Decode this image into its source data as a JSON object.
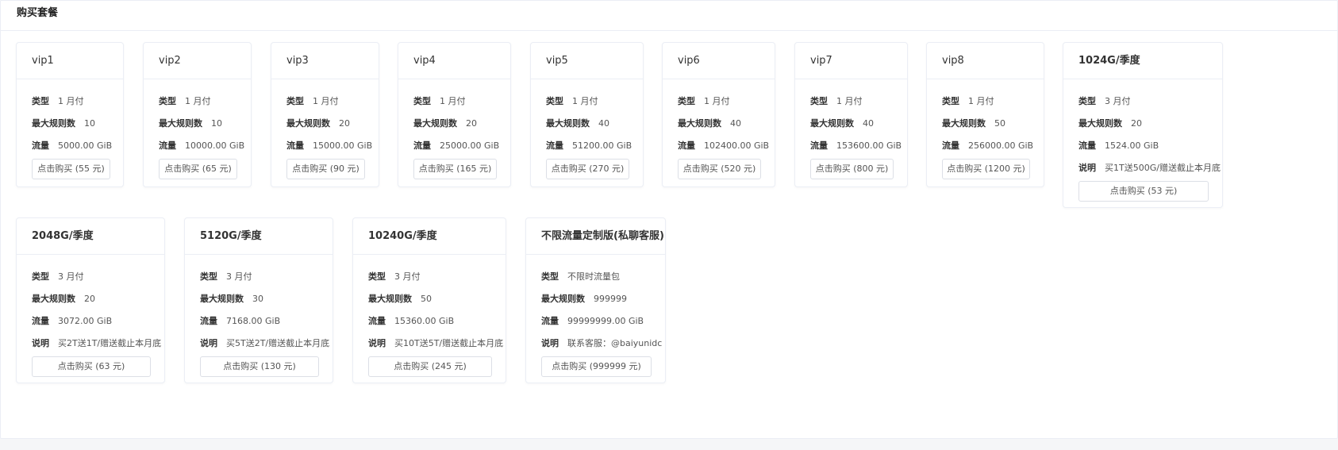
{
  "header": {
    "title": "购买套餐"
  },
  "labels": {
    "type": "类型",
    "max_rules": "最大规则数",
    "traffic": "流量",
    "desc": "说明"
  },
  "plans": [
    {
      "name": "vip1",
      "type": "1 月付",
      "max_rules": "10",
      "traffic": "5000.00 GiB",
      "buy_label": "点击购买 (55 元)"
    },
    {
      "name": "vip2",
      "type": "1 月付",
      "max_rules": "10",
      "traffic": "10000.00 GiB",
      "buy_label": "点击购买 (65 元)"
    },
    {
      "name": "vip3",
      "type": "1 月付",
      "max_rules": "20",
      "traffic": "15000.00 GiB",
      "buy_label": "点击购买 (90 元)"
    },
    {
      "name": "vip4",
      "type": "1 月付",
      "max_rules": "20",
      "traffic": "25000.00 GiB",
      "buy_label": "点击购买 (165 元)"
    },
    {
      "name": "vip5",
      "type": "1 月付",
      "max_rules": "40",
      "traffic": "51200.00 GiB",
      "buy_label": "点击购买 (270 元)"
    },
    {
      "name": "vip6",
      "type": "1 月付",
      "max_rules": "40",
      "traffic": "102400.00 GiB",
      "buy_label": "点击购买 (520 元)"
    },
    {
      "name": "vip7",
      "type": "1 月付",
      "max_rules": "40",
      "traffic": "153600.00 GiB",
      "buy_label": "点击购买 (800 元)"
    },
    {
      "name": "vip8",
      "type": "1 月付",
      "max_rules": "50",
      "traffic": "256000.00 GiB",
      "buy_label": "点击购买 (1200 元)"
    },
    {
      "name": "1024G/季度",
      "type": "3 月付",
      "max_rules": "20",
      "traffic": "1524.00 GiB",
      "desc": "买1T送500G/赠送截止本月底",
      "buy_label": "点击购买 (53 元)"
    },
    {
      "name": "2048G/季度",
      "type": "3 月付",
      "max_rules": "20",
      "traffic": "3072.00 GiB",
      "desc": "买2T送1T/赠送截止本月底",
      "buy_label": "点击购买 (63 元)"
    },
    {
      "name": "5120G/季度",
      "type": "3 月付",
      "max_rules": "30",
      "traffic": "7168.00 GiB",
      "desc": "买5T送2T/赠送截止本月底",
      "buy_label": "点击购买 (130 元)"
    },
    {
      "name": "10240G/季度",
      "type": "3 月付",
      "max_rules": "50",
      "traffic": "15360.00 GiB",
      "desc": "买10T送5T/赠送截止本月底",
      "buy_label": "点击购买 (245 元)"
    },
    {
      "name": "不限流量定制版(私聊客服)",
      "type": "不限时流量包",
      "max_rules": "999999",
      "traffic": "99999999.00 GiB",
      "desc": "联系客服：@baiyunidc",
      "buy_label": "点击购买 (999999 元)"
    }
  ]
}
